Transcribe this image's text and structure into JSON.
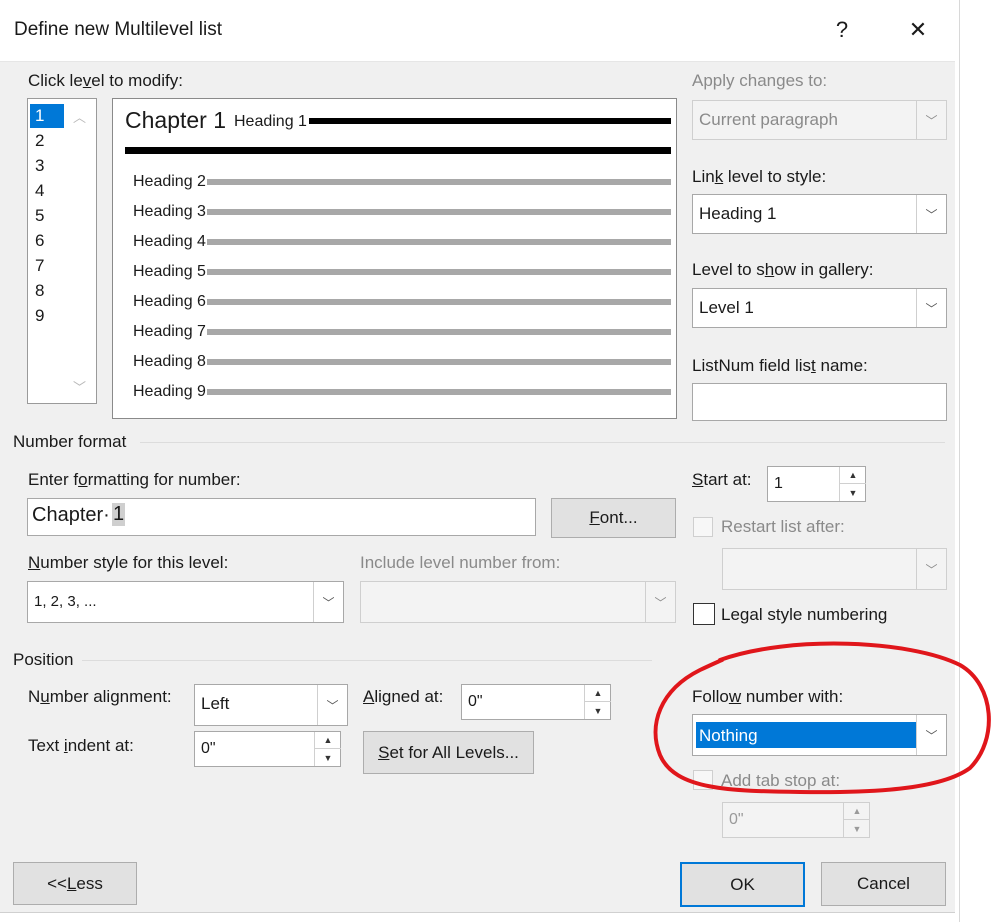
{
  "dialog": {
    "title": "Define new Multilevel list"
  },
  "titlebar": {
    "help": "?",
    "close": "✕"
  },
  "levels": {
    "label": "Click level to modify:",
    "items": [
      "1",
      "2",
      "3",
      "4",
      "5",
      "6",
      "7",
      "8",
      "9"
    ],
    "selected": "1"
  },
  "preview": {
    "chapter": "Chapter 1",
    "heading1": "Heading 1",
    "headings": [
      "Heading 2",
      "Heading 3",
      "Heading 4",
      "Heading 5",
      "Heading 6",
      "Heading 7",
      "Heading 8",
      "Heading 9"
    ]
  },
  "apply_changes": {
    "label": "Apply changes to:",
    "value": "Current paragraph"
  },
  "link_level": {
    "label": "Link level to style:",
    "value": "Heading 1"
  },
  "gallery_level": {
    "label": "Level to show in gallery:",
    "value": "Level 1"
  },
  "listnum": {
    "label": "ListNum field list name:",
    "value": ""
  },
  "number_format": {
    "section": "Number format",
    "enter_label": "Enter formatting for number:",
    "enter_text": "Chapter·",
    "enter_field": "1",
    "font_button": "Font...",
    "style_label": "Number style for this level:",
    "style_value": "1, 2, 3, ...",
    "include_label": "Include level number from:",
    "include_value": ""
  },
  "start_at": {
    "label": "Start at:",
    "value": "1"
  },
  "restart": {
    "label": "Restart list after:",
    "value": ""
  },
  "legal": {
    "label": "Legal style numbering"
  },
  "position": {
    "section": "Position",
    "alignment_label": "Number alignment:",
    "alignment_value": "Left",
    "aligned_label": "Aligned at:",
    "aligned_value": "0\"",
    "indent_label": "Text indent at:",
    "indent_value": "0\"",
    "set_all_button": "Set for All Levels..."
  },
  "follow": {
    "label": "Follow number with:",
    "value": "Nothing"
  },
  "tabstop": {
    "label": "Add tab stop at:",
    "value": "0\""
  },
  "buttons": {
    "less": "<< Less",
    "ok": "OK",
    "cancel": "Cancel"
  },
  "colors": {
    "accent": "#0078d7",
    "annotation": "#e0161b"
  }
}
